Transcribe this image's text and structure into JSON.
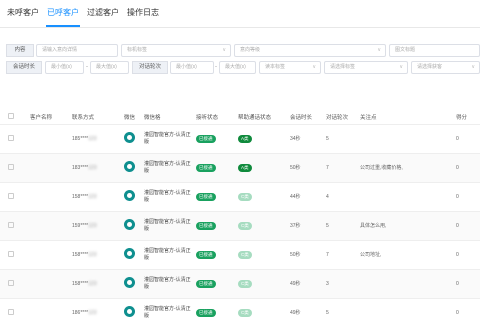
{
  "tabs": [
    "未呼客户",
    "已呼客户",
    "过滤客户",
    "操作日志"
  ],
  "filters": {
    "row1": {
      "content_label": "内容",
      "name_placeholder": "请输入意向详情",
      "group_placeholder": "标机标签",
      "task_placeholder": "意向等级",
      "title_placeholder": "图文标题"
    },
    "row2": {
      "duration_label": "会话时长",
      "min1": "最小值(s)",
      "max1": "最大值(s)",
      "rounds_label": "对话轮次",
      "min2": "最小值(s)",
      "max2": "最大值(s)",
      "read_placeholder": "读本标签",
      "tag_placeholder": "请选择标签",
      "source_placeholder": "请选择获客"
    }
  },
  "table": {
    "headers": [
      "",
      "客户名称",
      "联系方式",
      "微信",
      "微信格",
      "接听状态",
      "帮助通话状态",
      "会话时长",
      "对话轮次",
      "关注点",
      "",
      "得分"
    ],
    "rows": [
      {
        "phone": "185****",
        "wx": "灌园智能官方-认清正版",
        "answer": "已接通",
        "intent": "A类",
        "ic": "gd",
        "dur": "34秒",
        "rounds": "5",
        "focus": "",
        "score": "0"
      },
      {
        "phone": "183****",
        "wx": "灌园智能官方-认清正版",
        "answer": "已接通",
        "intent": "A类",
        "ic": "gd",
        "dur": "50秒",
        "rounds": "7",
        "focus": "公司过重,收藏价格,",
        "score": "0"
      },
      {
        "phone": "158****",
        "wx": "灌园智能官方-认清正版",
        "answer": "已接通",
        "intent": "C类",
        "ic": "gl",
        "dur": "44秒",
        "rounds": "4",
        "focus": "",
        "score": "0"
      },
      {
        "phone": "159****",
        "wx": "灌园智能官方-认清正版",
        "answer": "已接通",
        "intent": "C类",
        "ic": "gl",
        "dur": "37秒",
        "rounds": "5",
        "focus": "具体怎么用,",
        "score": "0"
      },
      {
        "phone": "158****",
        "wx": "灌园智能官方-认清正版",
        "answer": "已接通",
        "intent": "C类",
        "ic": "gl",
        "dur": "50秒",
        "rounds": "7",
        "focus": "公司地址,",
        "score": "0"
      },
      {
        "phone": "158****",
        "wx": "灌园智能官方-认清正版",
        "answer": "已接通",
        "intent": "C类",
        "ic": "gl",
        "dur": "49秒",
        "rounds": "3",
        "focus": "",
        "score": "0"
      },
      {
        "phone": "186****",
        "wx": "灌园智能官方-认清正版",
        "answer": "已接通",
        "intent": "C类",
        "ic": "gl",
        "dur": "49秒",
        "rounds": "5",
        "focus": "",
        "score": "0"
      }
    ]
  }
}
